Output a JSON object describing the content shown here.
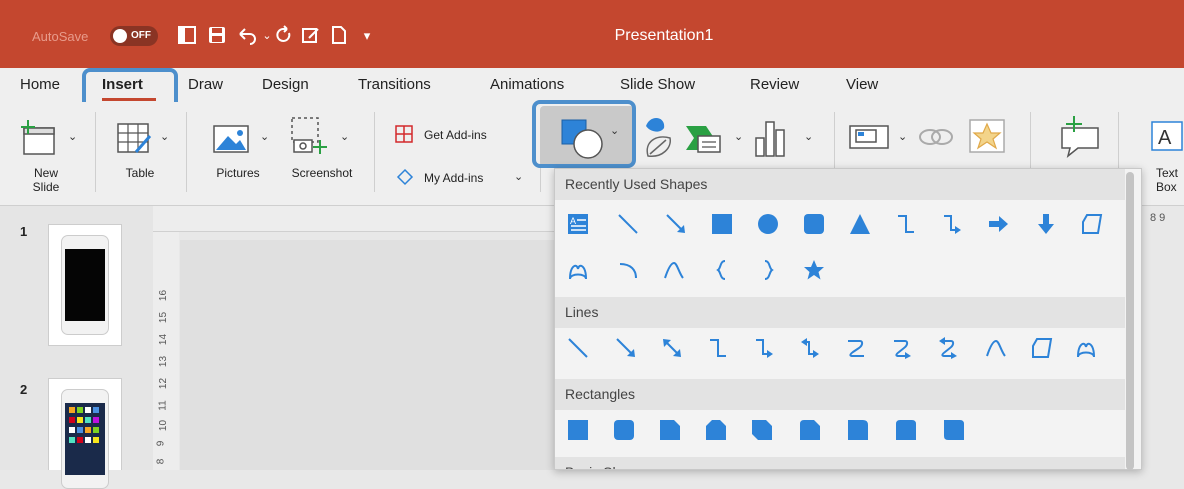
{
  "titlebar": {
    "autosave_label": "AutoSave",
    "autosave_state": "OFF",
    "title": "Presentation1",
    "brand_color": "#c4472f"
  },
  "tabs": [
    {
      "label": "Home"
    },
    {
      "label": "Insert",
      "active": true
    },
    {
      "label": "Draw"
    },
    {
      "label": "Design"
    },
    {
      "label": "Transitions"
    },
    {
      "label": "Animations"
    },
    {
      "label": "Slide Show"
    },
    {
      "label": "Review"
    },
    {
      "label": "View"
    }
  ],
  "ribbon": {
    "new_slide": "New\nSlide",
    "table": "Table",
    "pictures": "Pictures",
    "screenshot": "Screenshot",
    "get_addins": "Get Add-ins",
    "my_addins": "My Add-ins",
    "text_box": "Text\nBox"
  },
  "slides": [
    {
      "number": "1"
    },
    {
      "number": "2"
    }
  ],
  "ruler": {
    "vertical_numbers": [
      "16",
      "15",
      "14",
      "13",
      "12",
      "11",
      "10",
      "9",
      "8"
    ],
    "horizontal_right": "8 9"
  },
  "shapes_menu": {
    "sections": [
      {
        "title": "Recently Used Shapes",
        "icons": [
          "text-box-icon",
          "line-icon",
          "arrow-line-icon",
          "rectangle-icon",
          "oval-icon",
          "rounded-rectangle-icon",
          "triangle-icon",
          "elbow-connector-icon",
          "elbow-arrow-connector-icon",
          "right-arrow-icon",
          "down-arrow-icon",
          "freeform-icon",
          "scribble-icon",
          "arc-icon",
          "curve-icon",
          "left-brace-icon",
          "right-brace-icon",
          "star-icon"
        ]
      },
      {
        "title": "Lines",
        "icons": [
          "line-icon",
          "arrow-line-icon",
          "double-arrow-line-icon",
          "elbow-connector-icon",
          "elbow-arrow-connector-icon",
          "elbow-double-arrow-icon",
          "curved-connector-icon",
          "curved-arrow-connector-icon",
          "curved-double-arrow-icon",
          "curve-icon",
          "freeform-icon",
          "scribble-icon"
        ]
      },
      {
        "title": "Rectangles",
        "icons": [
          "rectangle-icon",
          "rounded-rectangle-icon",
          "snip-single-corner-icon",
          "snip-same-side-icon",
          "snip-diagonal-icon",
          "snip-round-icon",
          "round-single-corner-icon",
          "round-same-side-icon",
          "round-diagonal-icon"
        ]
      },
      {
        "title": "Basic Shapes",
        "icons": []
      }
    ]
  },
  "colors": {
    "accent": "#2d83d8",
    "highlight": "#4d8fcc"
  }
}
